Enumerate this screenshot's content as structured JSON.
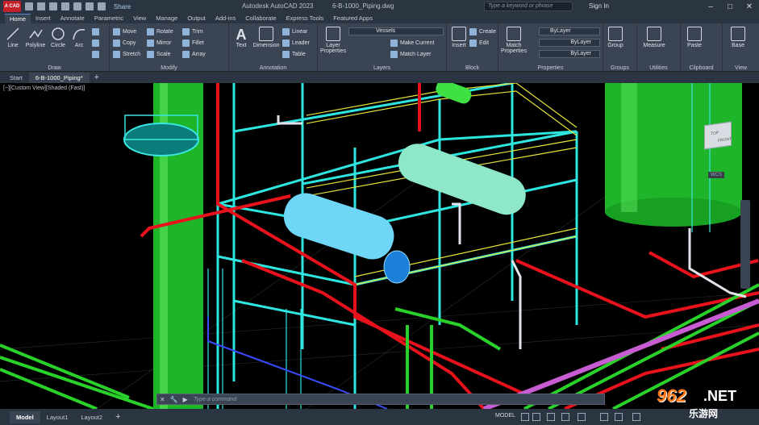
{
  "titlebar": {
    "app_logo": "A CAD",
    "share_label": "Share",
    "app_title": "Autodesk AutoCAD 2023",
    "file_title": "6-B-1000_Piping.dwg",
    "search_placeholder": "Type a keyword or phrase",
    "sign_in_label": "Sign In",
    "window_controls": [
      "–",
      "□",
      "✕"
    ]
  },
  "ribbon_tabs": [
    "Home",
    "Insert",
    "Annotate",
    "Parametric",
    "View",
    "Manage",
    "Output",
    "Add-ins",
    "Collaborate",
    "Express Tools",
    "Featured Apps"
  ],
  "ribbon": {
    "draw": {
      "label": "Draw",
      "tools": [
        "Line",
        "Polyline",
        "Circle",
        "Arc"
      ]
    },
    "modify": {
      "label": "Modify",
      "tools": [
        "Move",
        "Rotate",
        "Trim",
        "Copy",
        "Mirror",
        "Fillet",
        "Stretch",
        "Scale",
        "Array"
      ]
    },
    "annotation": {
      "label": "Annotation",
      "tools": [
        "Text",
        "Dimension",
        "Linear",
        "Leader",
        "Table"
      ]
    },
    "layers": {
      "label": "Layers",
      "big_tool": "Layer Properties",
      "current_layer": "Vessels",
      "tools": [
        "Make Current",
        "Match Layer"
      ]
    },
    "block": {
      "label": "Block",
      "big_tool": "Insert",
      "tools": [
        "Create",
        "Edit"
      ]
    },
    "properties": {
      "label": "Properties",
      "big_tool": "Match Properties",
      "color": "ByLayer",
      "linetype": "ByLayer",
      "lineweight": "ByLayer"
    },
    "groups": {
      "label": "Groups",
      "big_tool": "Group"
    },
    "utilities": {
      "label": "Utilities",
      "big_tool": "Measure"
    },
    "clipboard": {
      "label": "Clipboard",
      "big_tool": "Paste"
    },
    "view": {
      "label": "View",
      "big_tool": "Base"
    }
  },
  "doc_tabs": [
    "Start",
    "6-B-1000_Piping*"
  ],
  "viewport": {
    "label": "[−][Custom View][Shaded (Fast)]",
    "viewcube_top": "TOP",
    "viewcube_front": "FRONT",
    "wcs_label": "WCS"
  },
  "command_line": {
    "placeholder": "Type a command"
  },
  "statusbar": {
    "layout_tabs": [
      "Model",
      "Layout1",
      "Layout2"
    ],
    "model_label": "MODEL"
  },
  "watermark": {
    "big": "962",
    "net": ".NET",
    "sub": "乐游网"
  },
  "colors": {
    "accent": "#4b88d0",
    "structure": "#2ee6e0",
    "handrail": "#e8e63a",
    "pipe_red": "#e8121c",
    "pipe_green": "#2bd12b",
    "vessel": "#7de0ff"
  }
}
